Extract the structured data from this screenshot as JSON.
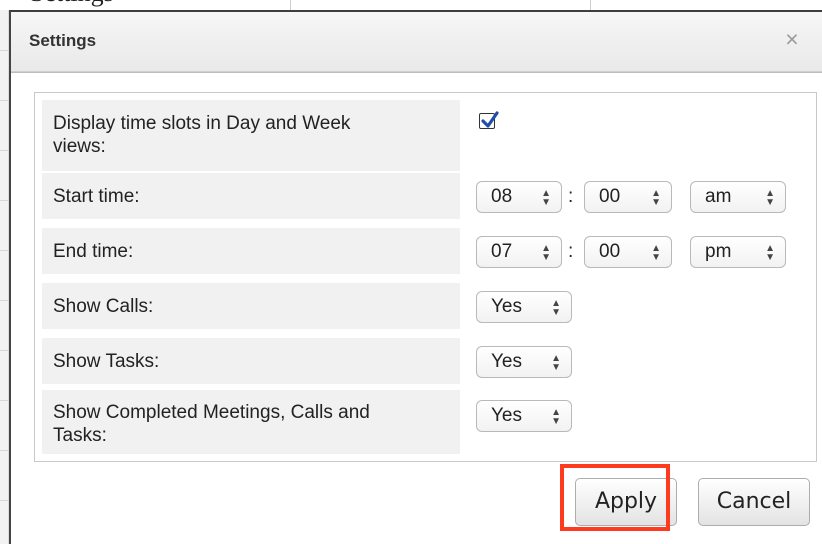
{
  "background": {
    "top_text": "Settings"
  },
  "dialog": {
    "title": "Settings",
    "close_glyph": "×",
    "rows": [
      {
        "label": "Display time slots in Day and Week views:",
        "label_lines": [
          "Display time slots in Day and Week",
          "views:"
        ],
        "control": "checkbox",
        "checked": true
      },
      {
        "label": "Start time:",
        "hour": "08",
        "separator": ":",
        "minute": "00",
        "meridiem": "am"
      },
      {
        "label": "End time:",
        "hour": "07",
        "separator": ":",
        "minute": "00",
        "meridiem": "pm"
      },
      {
        "label": "Show Calls:",
        "value": "Yes"
      },
      {
        "label": "Show Tasks:",
        "value": "Yes"
      },
      {
        "label": "Show Completed Meetings, Calls and Tasks:",
        "label_lines": [
          "Show Completed Meetings, Calls and",
          "Tasks:"
        ],
        "value": "Yes"
      }
    ],
    "select_arrow": "▲▼",
    "buttons": {
      "apply": "Apply",
      "cancel": "Cancel"
    }
  },
  "colors": {
    "highlight": "#ff3b1f",
    "checkmark": "#1f4fa8"
  }
}
